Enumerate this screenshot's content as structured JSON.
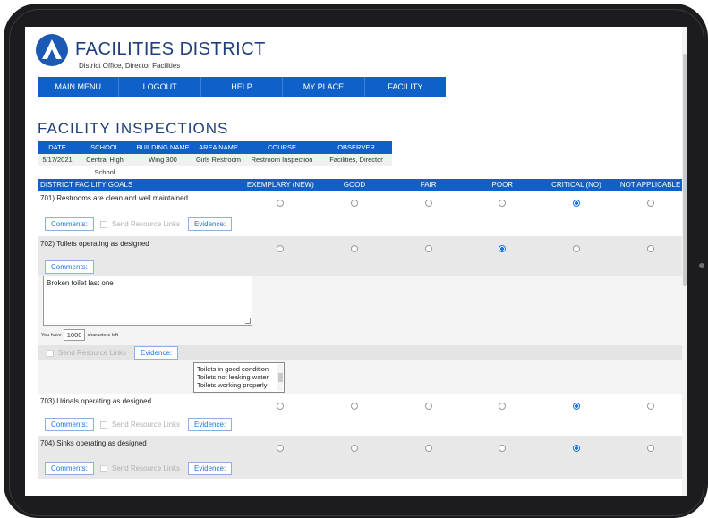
{
  "header": {
    "brand_name": "FACILITIES DISTRICT",
    "brand_sub": "District Office, Director Facilities"
  },
  "menu": [
    "MAIN MENU",
    "LOGOUT",
    "HELP",
    "MY PLACE",
    "FACILITY"
  ],
  "page_title": "FACILITY INSPECTIONS",
  "inspection": {
    "headers": [
      "DATE",
      "SCHOOL",
      "BUILDING NAME",
      "AREA NAME",
      "COURSE",
      "OBSERVER"
    ],
    "row": [
      "5/17/2021",
      "Central High School",
      "Wing 300",
      "Girls Restroom",
      "Restroom Inspection",
      "Facilities, Director"
    ]
  },
  "goals_header": {
    "title": "DISTRICT FACILITY GOALS",
    "options": [
      "EXEMPLARY (NEW)",
      "GOOD",
      "FAIR",
      "POOR",
      "CRITICAL (NO)",
      "NOT APPLICABLE"
    ]
  },
  "labels": {
    "comments": "Comments:",
    "send_links": "Send Resource Links",
    "evidence": "Evidence:",
    "you_have": "You have",
    "chars_left": "characters left"
  },
  "goals": [
    {
      "text": "701)  Restrooms are clean and well maintained",
      "selected": 4
    },
    {
      "text": "702)  Toilets operating as designed",
      "selected": 3,
      "comment": "Broken toilet last one",
      "char_count": "1000",
      "evidence_options": [
        "Toilets in good condition",
        "Toilets not leaking water",
        "Toilets working properly"
      ]
    },
    {
      "text": "703)  Urinals operating as designed",
      "selected": 4
    },
    {
      "text": "704)  Sinks operating as designed",
      "selected": 4
    }
  ],
  "colors": {
    "accent": "#0f61c9",
    "title": "#1f3f7a",
    "radio_on": "#1a73e8"
  }
}
